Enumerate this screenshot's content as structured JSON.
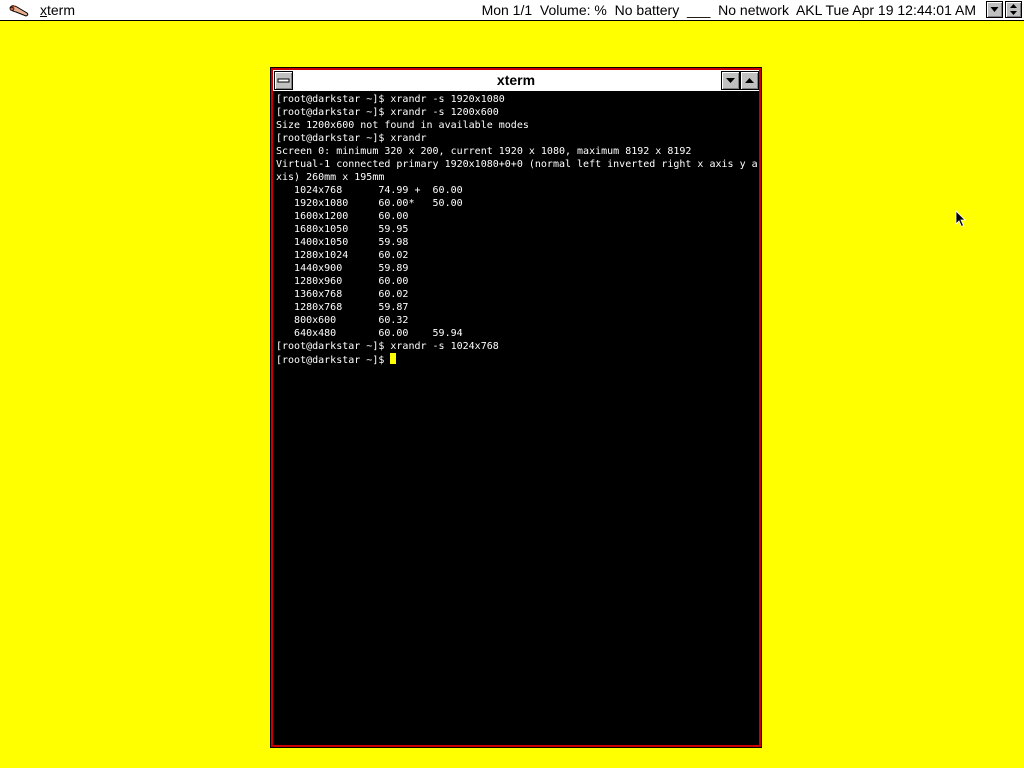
{
  "topbar": {
    "app_menu_prefix": "x",
    "app_menu_rest": "term",
    "status": "Mon 1/1  Volume: %  No battery  ___  No network  AKL Tue Apr 19 12:44:01 AM"
  },
  "xterm": {
    "title": "xterm",
    "lines": [
      "[root@darkstar ~]$ xrandr -s 1920x1080",
      "[root@darkstar ~]$ xrandr -s 1200x600",
      "Size 1200x600 not found in available modes",
      "[root@darkstar ~]$ xrandr",
      "Screen 0: minimum 320 x 200, current 1920 x 1080, maximum 8192 x 8192",
      "Virtual-1 connected primary 1920x1080+0+0 (normal left inverted right x axis y a",
      "xis) 260mm x 195mm",
      "   1024x768      74.99 +  60.00",
      "   1920x1080     60.00*   50.00",
      "   1600x1200     60.00",
      "   1680x1050     59.95",
      "   1400x1050     59.98",
      "   1280x1024     60.02",
      "   1440x900      59.89",
      "   1280x960      60.00",
      "   1360x768      60.02",
      "   1280x768      59.87",
      "   800x600       60.32",
      "   640x480       60.00    59.94",
      "[root@darkstar ~]$ xrandr -s 1024x768"
    ],
    "prompt": "[root@darkstar ~]$ "
  },
  "colors": {
    "desktop": "#ffff00",
    "window_border": "#c80000",
    "terminal_bg": "#000000",
    "terminal_fg": "#ffffff",
    "cursor": "#ffff00"
  },
  "icons": {
    "app_logo": "slackware-pipe-logo-icon",
    "panel_menu": "up-down-arrows-icon",
    "window_menu": "window-menu-icon",
    "minimize": "minimize-arrow-icon",
    "maximize": "maximize-arrow-icon",
    "pointer": "mouse-pointer-icon"
  }
}
